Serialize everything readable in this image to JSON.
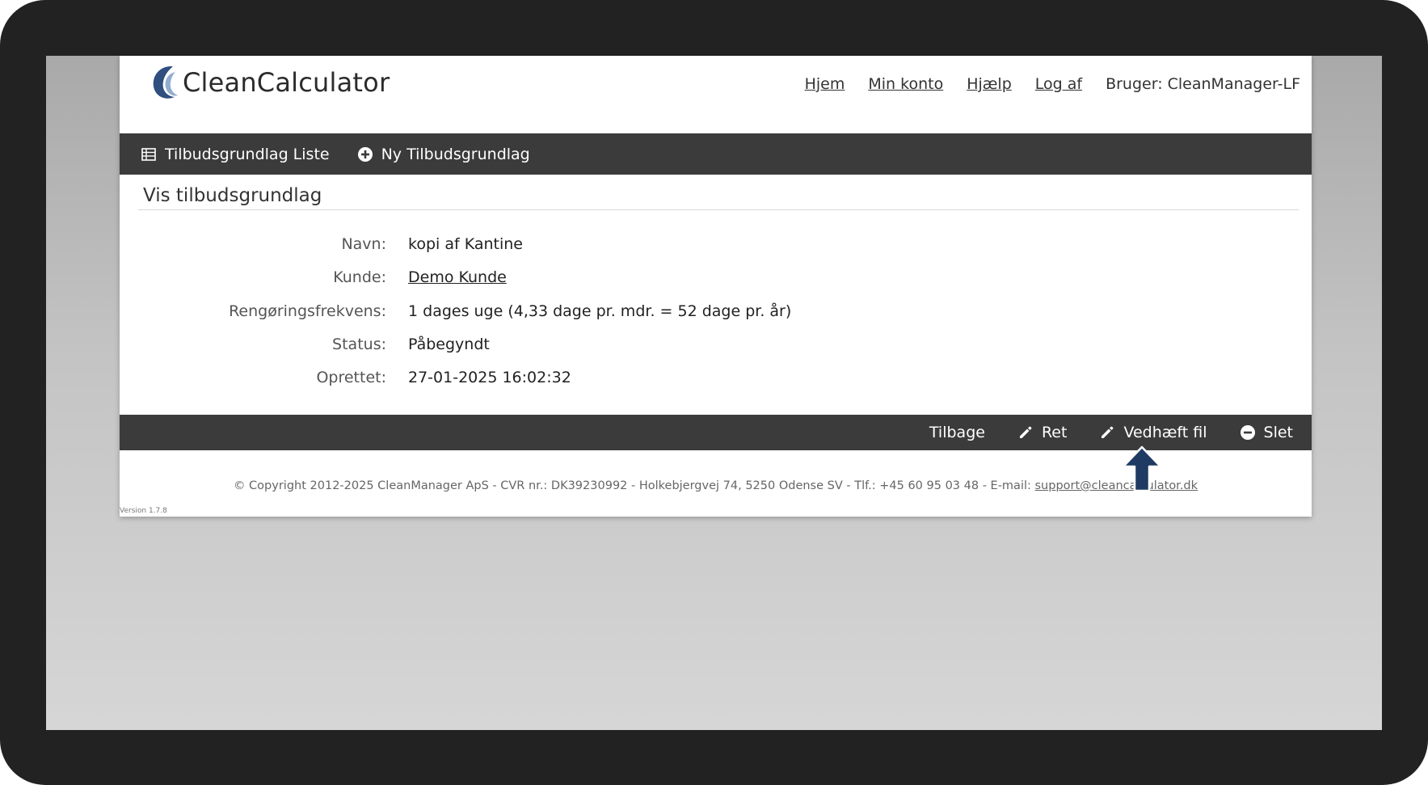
{
  "app": {
    "logo_text": "CleanCalculator"
  },
  "topnav": {
    "home": "Hjem",
    "account": "Min konto",
    "help": "Hjælp",
    "logout": "Log af",
    "user": "Bruger: CleanManager-LF"
  },
  "toolbar": {
    "list_label": "Tilbudsgrundlag Liste",
    "new_label": "Ny Tilbudsgrundlag"
  },
  "page": {
    "title": "Vis tilbudsgrundlag"
  },
  "details": [
    {
      "label": "Navn:",
      "value": "kopi af Kantine"
    },
    {
      "label": "Kunde:",
      "value": "Demo Kunde"
    },
    {
      "label": "Rengøringsfrekvens:",
      "value": "1 dages uge (4,33 dage pr. mdr. = 52 dage pr. år)"
    },
    {
      "label": "Status:",
      "value": "Påbegyndt"
    },
    {
      "label": "Oprettet:",
      "value": "27-01-2025 16:02:32"
    }
  ],
  "actions": {
    "back": "Tilbage",
    "edit": "Ret",
    "attach": "Vedhæft fil",
    "delete": "Slet"
  },
  "footer": {
    "copyright": "© Copyright 2012-2025 CleanManager ApS - CVR nr.: DK39230992 - Holkebjergvej 74, 5250 Odense SV - Tlf.: +45 60 95 03 48 - E-mail: ",
    "email": "support@cleancalculator.dk",
    "version": "Version 1.7.8"
  },
  "icons": {
    "logo": "wave-logo-icon",
    "list": "table-icon",
    "new": "plus-circle-icon",
    "edit": "pencil-icon",
    "attach": "pencil-icon",
    "delete": "minus-circle-icon",
    "pointer": "arrow-up-icon"
  },
  "colors": {
    "toolbar_bg": "#3b3b3b",
    "arrow": "#1f3b63",
    "logo_blue": "#2f4f7f"
  }
}
